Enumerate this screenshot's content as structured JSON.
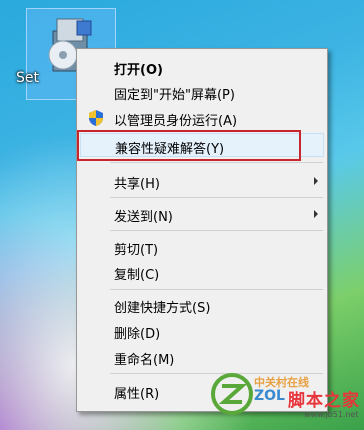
{
  "desktop": {
    "file_label": "Set",
    "file_icon": "setup-installer-icon"
  },
  "menu": {
    "items": [
      {
        "label": "打开(O)",
        "bold": true
      },
      {
        "label": "固定到\"开始\"屏幕(P)"
      },
      {
        "label": "以管理员身份运行(A)",
        "icon": "uac-shield-icon"
      },
      {
        "label": "兼容性疑难解答(Y)",
        "highlighted": true
      },
      {
        "label": "共享(H)",
        "submenu": true
      },
      {
        "label": "发送到(N)",
        "submenu": true
      },
      {
        "label": "剪切(T)"
      },
      {
        "label": "复制(C)"
      },
      {
        "label": "创建快捷方式(S)"
      },
      {
        "label": "删除(D)"
      },
      {
        "label": "重命名(M)"
      },
      {
        "label": "属性(R)"
      }
    ],
    "highlight_color": "#c8262e"
  },
  "watermark": {
    "cn": "中关村在线",
    "zol": "ZOL",
    "jb": "脚本之家",
    "url": "www.jb51.net"
  }
}
